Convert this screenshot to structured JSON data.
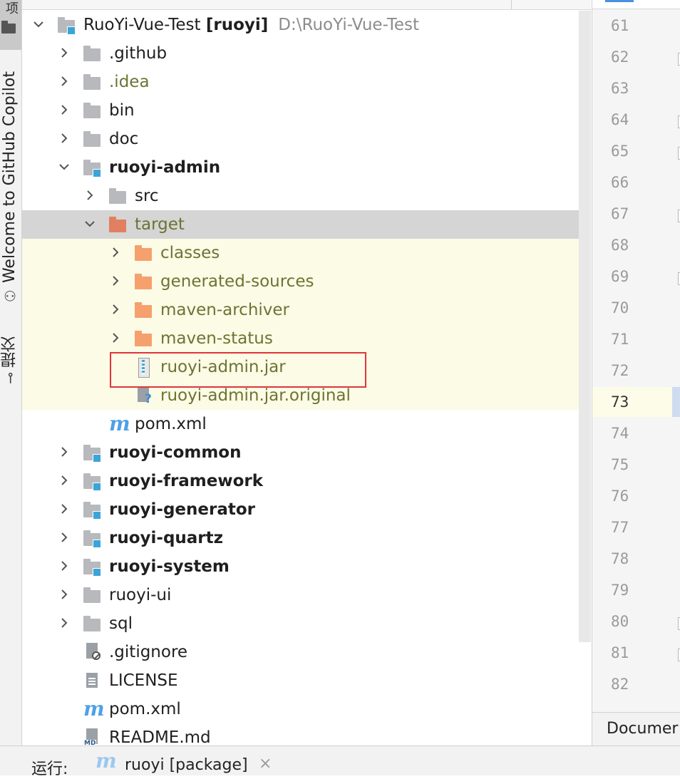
{
  "tool_strip": {
    "top_tab_glyph": "项",
    "copilot_label": "Welcome to GitHub Copilot",
    "commit_label": "提交"
  },
  "tree": {
    "root": {
      "name": "RuoYi-Vue-Test",
      "module": "[ruoyi]",
      "path": "D:\\RuoYi-Vue-Test"
    },
    "items": [
      {
        "label": ".github"
      },
      {
        "label": ".idea"
      },
      {
        "label": "bin"
      },
      {
        "label": "doc"
      },
      {
        "label": "ruoyi-admin"
      },
      {
        "label": "src"
      },
      {
        "label": "target"
      },
      {
        "label": "classes"
      },
      {
        "label": "generated-sources"
      },
      {
        "label": "maven-archiver"
      },
      {
        "label": "maven-status"
      },
      {
        "label": "ruoyi-admin.jar"
      },
      {
        "label": "ruoyi-admin.jar.original"
      },
      {
        "label": "pom.xml"
      },
      {
        "label": "ruoyi-common"
      },
      {
        "label": "ruoyi-framework"
      },
      {
        "label": "ruoyi-generator"
      },
      {
        "label": "ruoyi-quartz"
      },
      {
        "label": "ruoyi-system"
      },
      {
        "label": "ruoyi-ui"
      },
      {
        "label": "sql"
      },
      {
        "label": ".gitignore"
      },
      {
        "label": "LICENSE"
      },
      {
        "label": "pom.xml"
      },
      {
        "label": "README.md"
      }
    ],
    "highlighted_item": "ruoyi-admin.jar"
  },
  "gutter": {
    "line_numbers": [
      "61",
      "62",
      "63",
      "64",
      "65",
      "66",
      "67",
      "68",
      "69",
      "70",
      "71",
      "72",
      "73",
      "74",
      "75",
      "76",
      "77",
      "78",
      "79",
      "80",
      "81",
      "82"
    ],
    "current_line": "73",
    "bottom_tab": "Documer"
  },
  "run_bar": {
    "label": "运行:",
    "config_name": "ruoyi [package]",
    "close_glyph": "×"
  },
  "colors": {
    "excluded_folder": "#f5a06d",
    "excluded_text": "#6c7433",
    "excluded_background": "#fbfbe6",
    "module_badge": "#3ba4d9",
    "maven_icon": "#4fa0e6",
    "highlight_border": "#e0353a",
    "selection": "#d5d5d5"
  }
}
